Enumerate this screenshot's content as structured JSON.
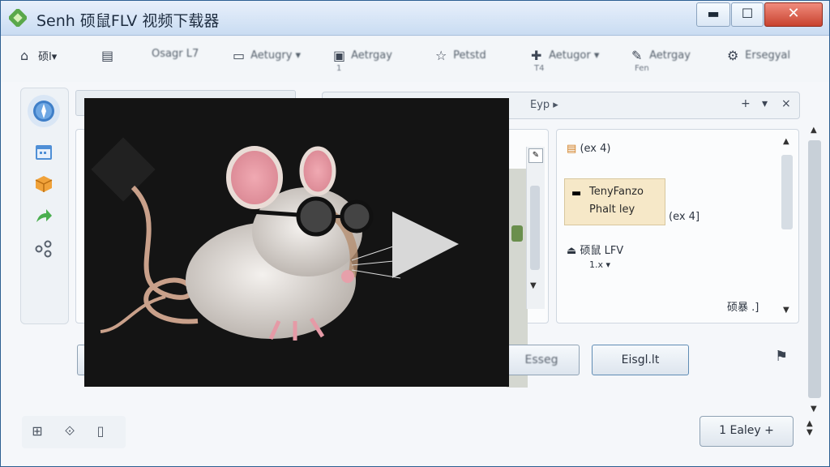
{
  "window": {
    "title": "Senh 硕鼠FLV 视频下载器",
    "controls": {
      "minimize": "▬",
      "maximize": "☐",
      "close": "✕"
    }
  },
  "toolbar": {
    "items": [
      {
        "icon": "home-icon",
        "label": "硕l▾",
        "sub": ""
      },
      {
        "icon": "folder-icon",
        "label": "",
        "sub": ""
      },
      {
        "icon": "",
        "label": "Osagr L7",
        "sub": ""
      },
      {
        "icon": "screen-icon",
        "label": "Aetugry ▾",
        "sub": ""
      },
      {
        "icon": "calendar-icon",
        "label": "Aetrgay",
        "sub": "1"
      },
      {
        "icon": "star-icon",
        "label": "Petstd",
        "sub": ""
      },
      {
        "icon": "plus-icon",
        "label": "Aetugor ▾",
        "sub": "T4"
      },
      {
        "icon": "pin-icon",
        "label": "Aetrgay",
        "sub": "Fen"
      },
      {
        "icon": "gear-icon",
        "label": "Ersegyal",
        "sub": ""
      }
    ]
  },
  "sidebar": {
    "items": [
      {
        "name": "compass-icon",
        "glyph": "✦"
      },
      {
        "name": "calendar-icon",
        "glyph": "▦"
      },
      {
        "name": "package-icon",
        "glyph": "◈"
      },
      {
        "name": "arrow-icon",
        "glyph": "➜"
      },
      {
        "name": "share-icon",
        "glyph": "⁂"
      }
    ]
  },
  "search": {
    "placeholder": "Eyp ▸",
    "buttons": [
      "+",
      "▾",
      "×"
    ]
  },
  "right_panel": {
    "item1": "(ex 4)",
    "selected_line1": "TenyFanzo",
    "selected_line2": "Phalt ley",
    "selected_count": "(ex 4]",
    "item3_title": "硕鼠 LFV",
    "item3_sub": "1.x ▾",
    "footer": "硕暴 .]"
  },
  "buttons": {
    "middle": "Esseg",
    "right": "Eisgl.lt",
    "primary": "1 Ealey +"
  },
  "colors": {
    "accent": "#5f8cb4",
    "selection": "#f6e8c8",
    "titlebar": "#c9dcf2",
    "close": "#c8432f"
  }
}
